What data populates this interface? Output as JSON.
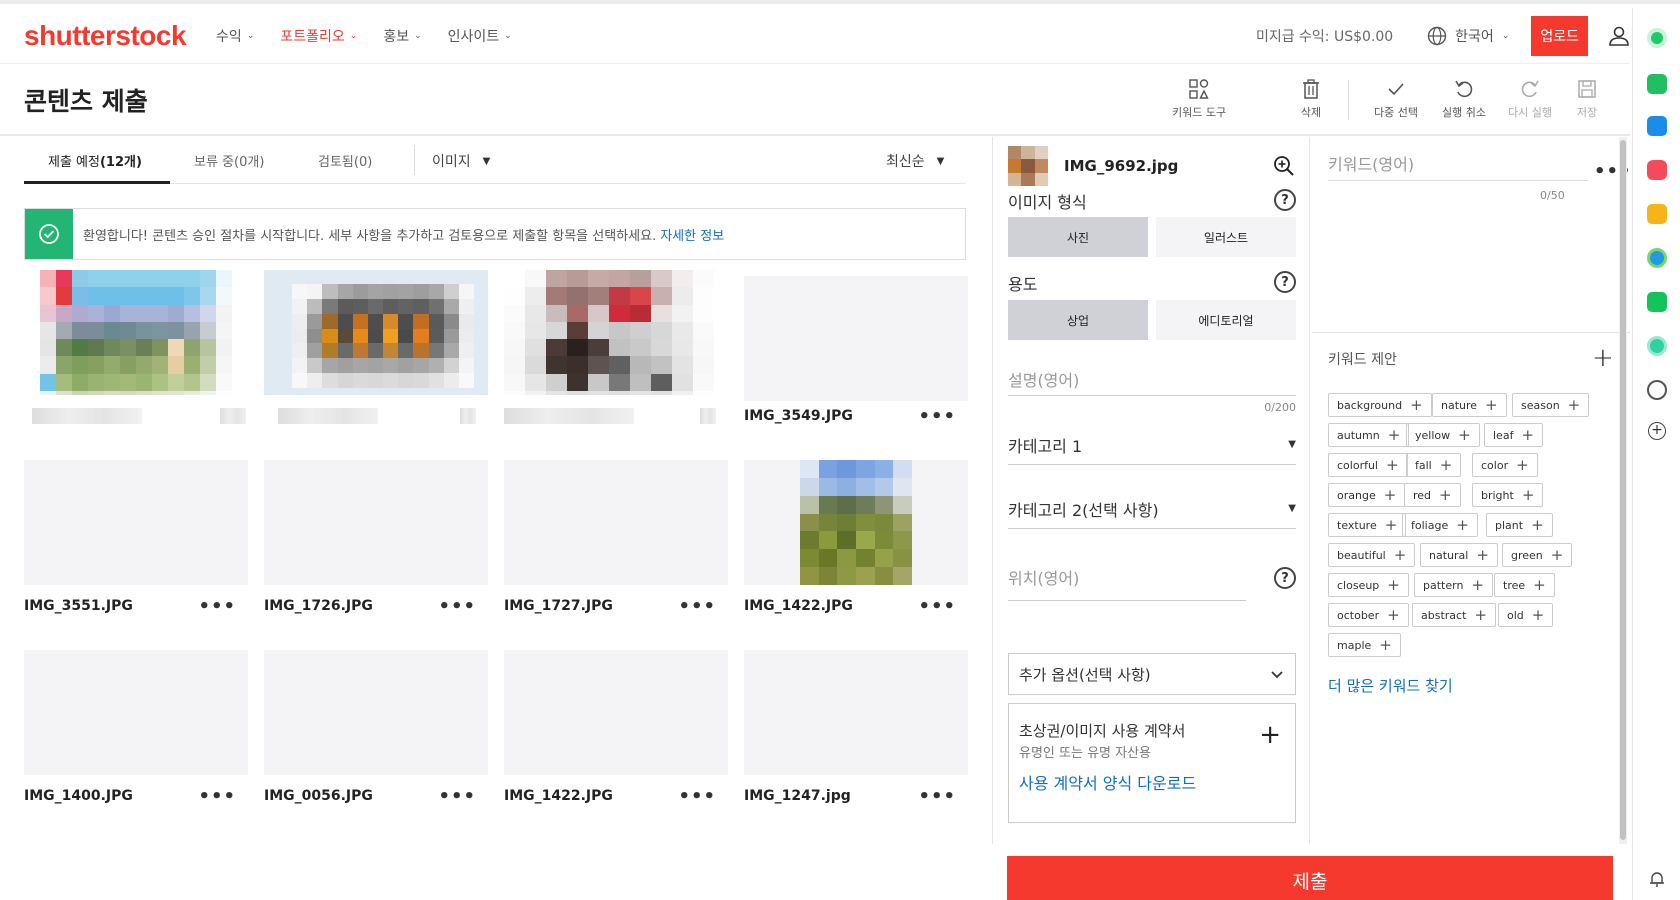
{
  "brand": {
    "logo_text": "shutterstock",
    "accent": "#f5392e"
  },
  "nav": {
    "items": [
      {
        "label": "수익"
      },
      {
        "label": "포트폴리오",
        "active": true
      },
      {
        "label": "홍보"
      },
      {
        "label": "인사이트"
      }
    ],
    "earnings": "미지급 수익: US$0.00",
    "language": "한국어",
    "upload_label": "업로드"
  },
  "page": {
    "title": "콘텐츠 제출",
    "tools": {
      "keyword_tool": "키워드 도구",
      "delete": "삭제",
      "multi_select": "다중 선택",
      "undo": "실행 취소",
      "redo": "다시 실행",
      "save": "저장"
    }
  },
  "tabs": [
    {
      "label": "제출 예정",
      "count": "(12개)",
      "active": true
    },
    {
      "label": "보류 중",
      "count": "(0개)"
    },
    {
      "label": "검토됨",
      "count": "(0)"
    }
  ],
  "filter": {
    "media_type": "이미지",
    "sort": "최신순"
  },
  "banner": {
    "text": "환영합니다! 콘텐츠 승인 절차를 시작합니다. 세부 사항을 추가하고 검토용으로 제출할 항목을 선택하세요.",
    "link": "자세한 정보"
  },
  "files": [
    {
      "name": "",
      "blurred": true
    },
    {
      "name": "",
      "blurred": true
    },
    {
      "name": "",
      "blurred": true
    },
    {
      "name": "IMG_3549.JPG"
    },
    {
      "name": "IMG_3551.JPG"
    },
    {
      "name": "IMG_1726.JPG"
    },
    {
      "name": "IMG_1727.JPG"
    },
    {
      "name": "IMG_1422.JPG"
    },
    {
      "name": "IMG_1400.JPG"
    },
    {
      "name": "IMG_0056.JPG"
    },
    {
      "name": "IMG_1422.JPG"
    },
    {
      "name": "IMG_1247.jpg"
    }
  ],
  "form": {
    "file_name": "IMG_9692.jpg",
    "image_type_label": "이미지 형식",
    "image_type_options": [
      "사진",
      "일러스트"
    ],
    "usage_label": "용도",
    "usage_options": [
      "상업",
      "에디토리얼"
    ],
    "description_placeholder": "설명(영어)",
    "description_counter": "0/200",
    "category1": "카테고리 1",
    "category2": "카테고리 2(선택 사항)",
    "location_placeholder": "위치(영어)",
    "extra_options": "추가 옵션(선택 사항)",
    "release_title": "초상권/이미지 사용 계약서",
    "release_sub": "유명인 또는 유명 자산용",
    "release_link": "사용 계약서 양식 다운로드",
    "submit_label": "제출"
  },
  "keywords": {
    "placeholder": "키워드(영어)",
    "counter": "0/50",
    "suggest_title": "키워드 제안",
    "suggestions": [
      "background",
      "nature",
      "season",
      "autumn",
      "yellow",
      "leaf",
      "colorful",
      "fall",
      "color",
      "orange",
      "red",
      "bright",
      "texture",
      "foliage",
      "plant",
      "beautiful",
      "natural",
      "green",
      "closeup",
      "pattern",
      "tree",
      "october",
      "abstract",
      "old",
      "maple"
    ],
    "more_link": "더 많은 키워드 찾기"
  }
}
